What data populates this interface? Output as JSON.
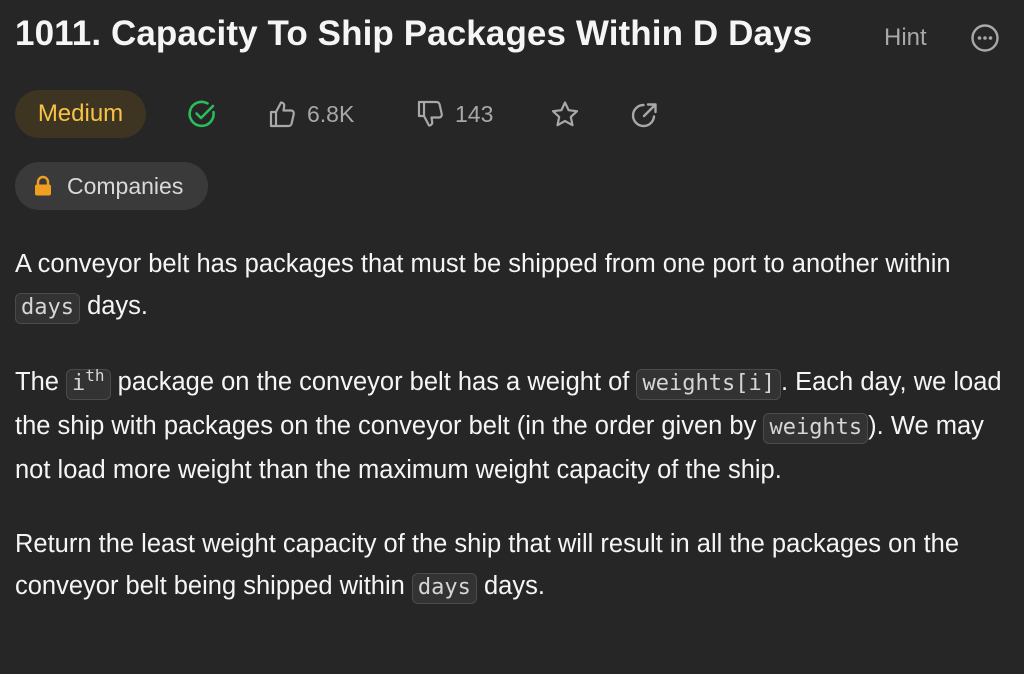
{
  "problem": {
    "title": "1011. Capacity To Ship Packages Within D Days",
    "hint_label": "Hint",
    "difficulty": "Medium",
    "likes": "6.8K",
    "dislikes": "143",
    "companies_label": "Companies"
  },
  "description": {
    "p1": {
      "t1": "A conveyor belt has packages that must be shipped from one port to another within ",
      "c1": "days",
      "t2": " days."
    },
    "p2": {
      "t1": "The ",
      "c1_base": "i",
      "c1_sup": "th",
      "t2": " package on the conveyor belt has a weight of ",
      "c2": "weights[i]",
      "t3": ". Each day, we load the ship with packages on the conveyor belt (in the order given by ",
      "c3": "weights",
      "t4": "). We may not load more weight than the maximum weight capacity of the ship."
    },
    "p3": {
      "t1": "Return the least weight capacity of the ship that will result in all the packages on the conveyor belt being shipped within ",
      "c1": "days",
      "t2": " days."
    }
  },
  "icons": {
    "solved": "check-circle-icon",
    "like": "thumbs-up-icon",
    "dislike": "thumbs-down-icon",
    "favorite": "star-icon",
    "share": "share-icon",
    "more": "more-options-icon",
    "lock": "lock-icon"
  },
  "colors": {
    "background": "#262626",
    "difficulty_text": "#f6c344",
    "difficulty_bg": "#3d3421",
    "solved_green": "#2cbb5d",
    "muted": "#a8a8a8",
    "lock_orange": "#f0a020"
  }
}
